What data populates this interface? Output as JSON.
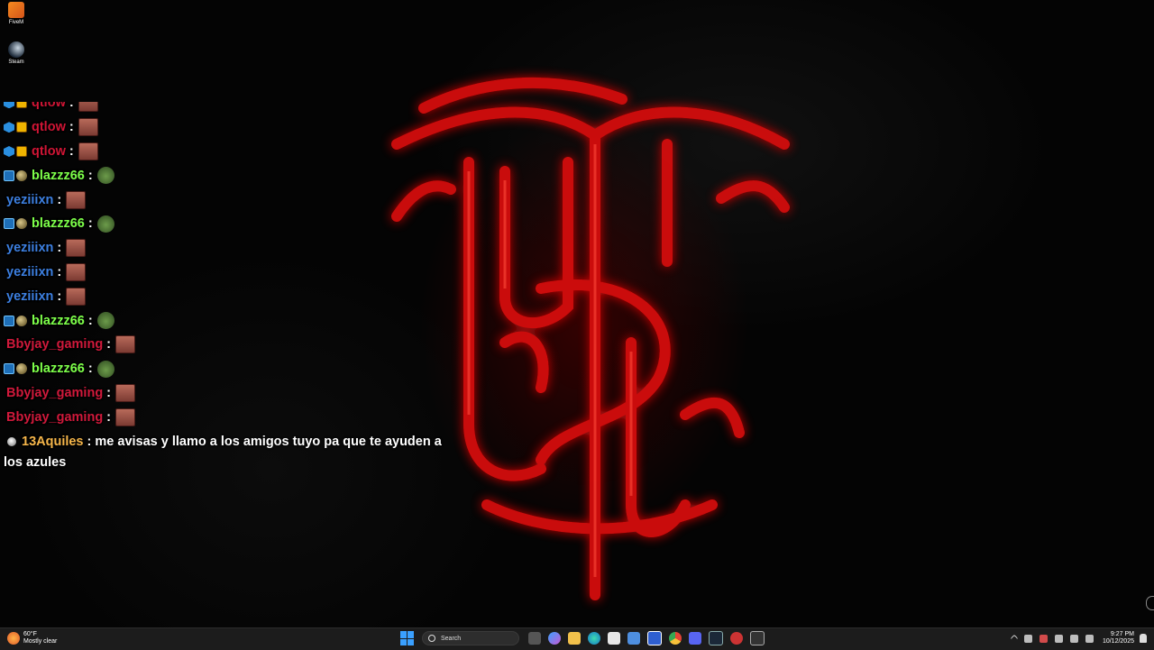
{
  "desktop_icons": [
    {
      "label": "FiveM",
      "icon": "fivem-icon"
    },
    {
      "label": "Steam",
      "icon": "steam-icon"
    }
  ],
  "chat": {
    "messages": [
      {
        "user": "qtlow",
        "color": "#d01535",
        "badges": [
          "prime-cube",
          "crown"
        ],
        "emote": "face-emote"
      },
      {
        "user": "qtlow",
        "color": "#d01535",
        "badges": [
          "prime-cube",
          "crown"
        ],
        "emote": "face-emote"
      },
      {
        "user": "qtlow",
        "color": "#d01535",
        "badges": [
          "prime-cube",
          "crown"
        ],
        "emote": "face-emote"
      },
      {
        "user": "blazzz66",
        "color": "#7dff4a",
        "badges": [
          "tool",
          "orb"
        ],
        "emote": "frog-emote"
      },
      {
        "user": "yeziiixn",
        "color": "#3c7fe0",
        "badges": [],
        "emote": "face-emote"
      },
      {
        "user": "blazzz66",
        "color": "#7dff4a",
        "badges": [
          "tool",
          "orb"
        ],
        "emote": "frog-emote"
      },
      {
        "user": "yeziiixn",
        "color": "#3c7fe0",
        "badges": [],
        "emote": "face-emote"
      },
      {
        "user": "yeziiixn",
        "color": "#3c7fe0",
        "badges": [],
        "emote": "face-emote"
      },
      {
        "user": "yeziiixn",
        "color": "#3c7fe0",
        "badges": [],
        "emote": "face-emote"
      },
      {
        "user": "blazzz66",
        "color": "#7dff4a",
        "badges": [
          "tool",
          "orb"
        ],
        "emote": "frog-emote"
      },
      {
        "user": "Bbyjay_gaming",
        "color": "#d0193b",
        "badges": [],
        "emote": "face-emote"
      },
      {
        "user": "blazzz66",
        "color": "#7dff4a",
        "badges": [
          "tool",
          "orb"
        ],
        "emote": "frog-emote"
      },
      {
        "user": "Bbyjay_gaming",
        "color": "#d0193b",
        "badges": [],
        "emote": "face-emote"
      },
      {
        "user": "Bbyjay_gaming",
        "color": "#d0193b",
        "badges": [],
        "emote": "face-emote"
      }
    ],
    "last_message": {
      "user": "13Aquiles",
      "color": "#f6b64a",
      "text": "me avisas y llamo a los amigos tuyo pa que te ayuden a los azules"
    },
    "colon": ":"
  },
  "taskbar": {
    "weather_temp": "60°F",
    "weather_desc": "Mostly clear",
    "search_placeholder": "Search",
    "time": "9:27 PM",
    "date": "10/12/2025"
  }
}
